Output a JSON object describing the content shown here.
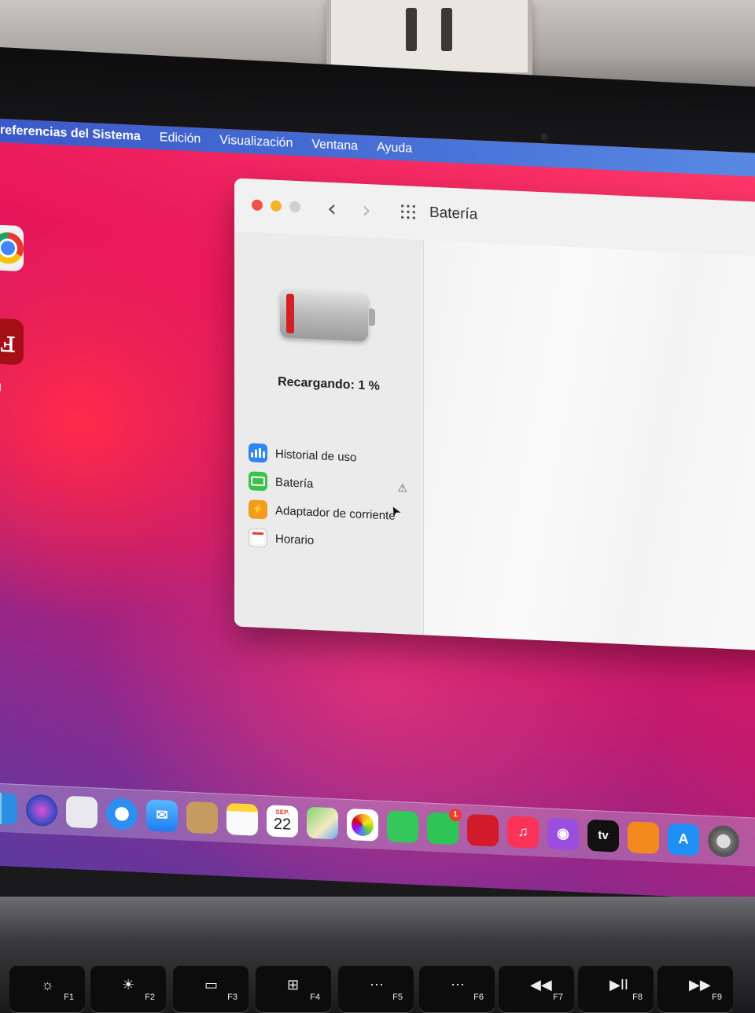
{
  "menubar": {
    "app_name": "referencias del Sistema",
    "items": [
      "Edición",
      "Visualización",
      "Ventana",
      "Ayuda"
    ]
  },
  "desktop": {
    "pdf_label": "u"
  },
  "window": {
    "title": "Batería",
    "nav_back": "‹",
    "nav_forward": "›",
    "status_text": "Recargando: 1 %",
    "battery_level_percent": 1,
    "sidebar_items": [
      {
        "label": "Historial de uso",
        "icon": "bar-chart-icon"
      },
      {
        "label": "Batería",
        "icon": "battery-icon",
        "warning": true
      },
      {
        "label": "Adaptador de corriente",
        "icon": "power-adapter-icon"
      },
      {
        "label": "Horario",
        "icon": "calendar-icon"
      }
    ],
    "warning_symbol": "⚠",
    "cursor_symbol": "➤"
  },
  "dock": {
    "calendar_month": "SEP.",
    "calendar_day": "22",
    "facetime_badge": "1",
    "tv_label": "tv"
  },
  "keyboard": {
    "keys": [
      {
        "label": "F1",
        "symbol": "☼"
      },
      {
        "label": "F2",
        "symbol": "☀"
      },
      {
        "label": "F3",
        "symbol": "▭"
      },
      {
        "label": "F4",
        "symbol": "⊞"
      },
      {
        "label": "F5",
        "symbol": "⋯"
      },
      {
        "label": "F6",
        "symbol": "⋯"
      },
      {
        "label": "F7",
        "symbol": "◀◀"
      },
      {
        "label": "F8",
        "symbol": "▶II"
      },
      {
        "label": "F9",
        "symbol": "▶▶"
      }
    ]
  },
  "colors": {
    "menubar": "#4a74d8",
    "battery_red": "#d41f25",
    "close": "#f0524b",
    "minimize": "#f1b32a"
  }
}
